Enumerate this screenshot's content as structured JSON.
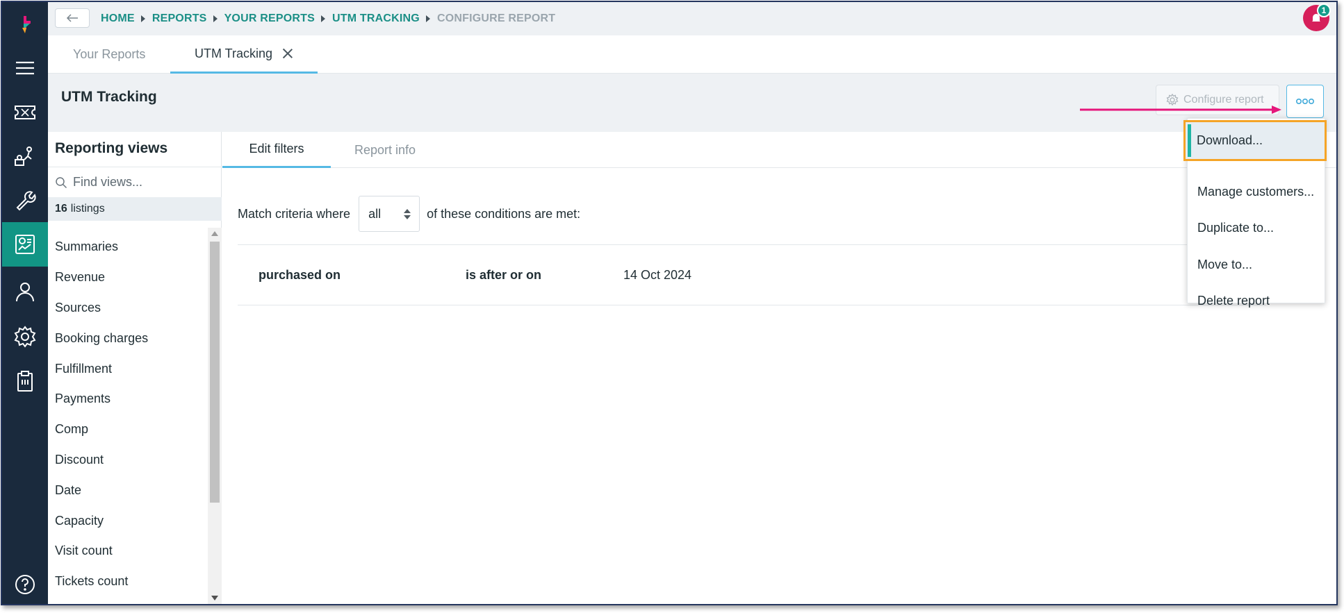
{
  "topbar": {
    "breadcrumbs": [
      "HOME",
      "REPORTS",
      "YOUR REPORTS",
      "UTM TRACKING",
      "CONFIGURE REPORT"
    ],
    "notification_count": "1"
  },
  "report_tabs": {
    "your_reports": "Your Reports",
    "current": "UTM Tracking"
  },
  "header": {
    "title": "UTM Tracking",
    "configure_label": "Configure report"
  },
  "menu": {
    "items": [
      "Download...",
      "Manage customers...",
      "Duplicate to...",
      "Move to...",
      "Delete report"
    ]
  },
  "views": {
    "title": "Reporting views",
    "search_placeholder": "Find views...",
    "listing_count": "16",
    "listing_label": "listings",
    "items": [
      "Summaries",
      "Revenue",
      "Sources",
      "Booking charges",
      "Fulfillment",
      "Payments",
      "Comp",
      "Discount",
      "Date",
      "Capacity",
      "Visit count",
      "Tickets count"
    ]
  },
  "content": {
    "tabs": [
      "Edit filters",
      "Report info"
    ],
    "criteria_prefix": "Match criteria where",
    "criteria_value": "all",
    "criteria_suffix": "of these conditions are met:",
    "condition": {
      "field": "purchased on",
      "operator": "is after or on",
      "value": "14 Oct 2024"
    }
  },
  "colors": {
    "nav_bg": "#1a2a3d",
    "accent_teal": "#129585",
    "link_teal": "#1b8f86",
    "highlight_orange": "#f5a427",
    "arrow_pink": "#e5177b",
    "tab_underline": "#55b9e4"
  },
  "icons": [
    "logo-icon",
    "hamburger-icon",
    "ticket-icon",
    "activities-icon",
    "wrench-icon",
    "reports-icon",
    "person-icon",
    "gear-icon",
    "clipboard-icon",
    "help-icon",
    "search-icon",
    "bell-icon",
    "more-icon"
  ]
}
